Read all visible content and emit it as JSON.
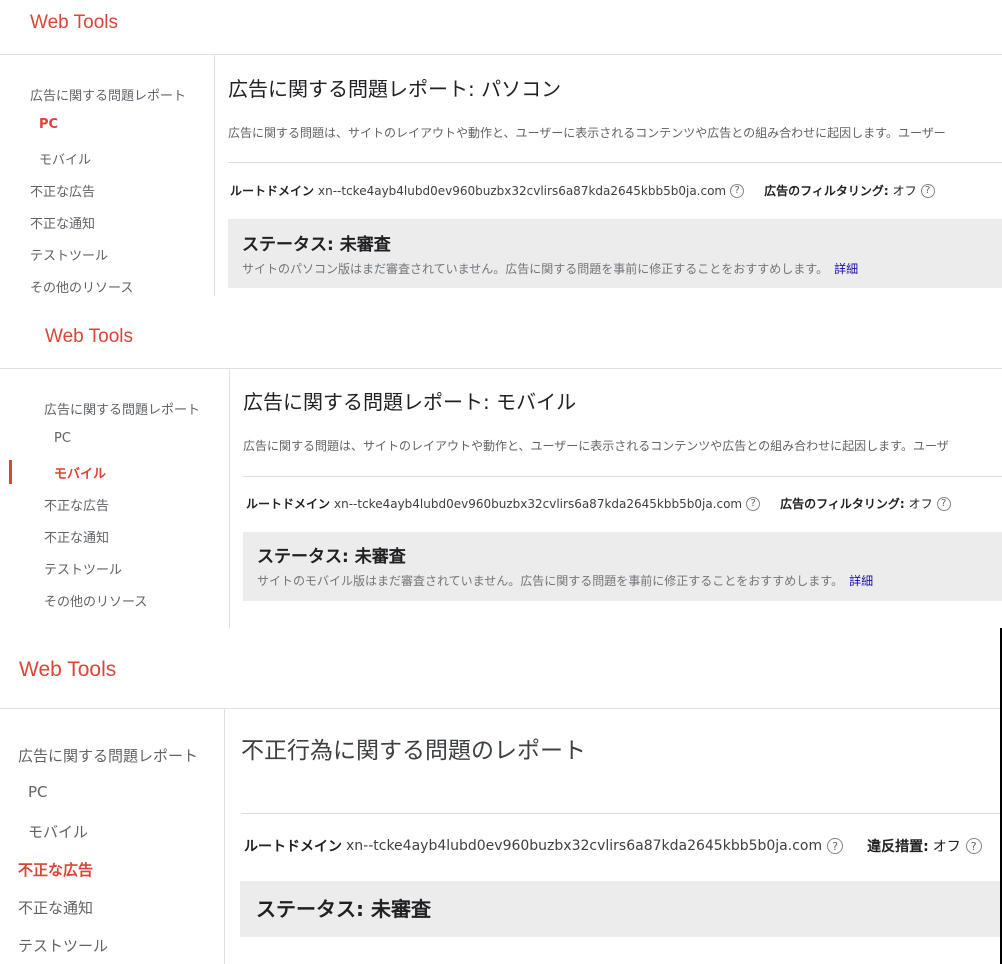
{
  "brand": "Web Tools",
  "panels": [
    {
      "nav": [
        "広告に関する問題レポート",
        "PC",
        "モバイル",
        "不正な広告",
        "不正な通知",
        "テストツール",
        "その他のリソース"
      ],
      "active_index": 1,
      "title": "広告に関する問題レポート: パソコン",
      "description": "広告に関する問題は、サイトのレイアウトや動作と、ユーザーに表示されるコンテンツや広告との組み合わせに起因します。ユーザー",
      "domain_label": "ルートドメイン",
      "domain": "xn--tcke4ayb4lubd0ev960buzbx32cvlirs6a87kda2645kbb5b0ja.com",
      "filter_label": "広告のフィルタリング:",
      "filter_value": "オフ",
      "status": "ステータス: 未審査",
      "status_desc": "サイトのパソコン版はまだ審査されていません。広告に関する問題を事前に修正することをおすすめします。",
      "details_link": "詳細"
    },
    {
      "nav": [
        "広告に関する問題レポート",
        "PC",
        "モバイル",
        "不正な広告",
        "不正な通知",
        "テストツール",
        "その他のリソース"
      ],
      "active_index": 2,
      "title": "広告に関する問題レポート: モバイル",
      "description": "広告に関する問題は、サイトのレイアウトや動作と、ユーザーに表示されるコンテンツや広告との組み合わせに起因します。ユーザ",
      "domain_label": "ルートドメイン",
      "domain": "xn--tcke4ayb4lubd0ev960buzbx32cvlirs6a87kda2645kbb5b0ja.com",
      "filter_label": "広告のフィルタリング:",
      "filter_value": "オフ",
      "status": "ステータス: 未審査",
      "status_desc": "サイトのモバイル版はまだ審査されていません。広告に関する問題を事前に修正することをおすすめします。",
      "details_link": "詳細"
    },
    {
      "nav": [
        "広告に関する問題レポート",
        "PC",
        "モバイル",
        "不正な広告",
        "不正な通知",
        "テストツール"
      ],
      "active_index": 3,
      "title": "不正行為に関する問題のレポート",
      "domain_label": "ルートドメイン",
      "domain": "xn--tcke4ayb4lubd0ev960buzbx32cvlirs6a87kda2645kbb5b0ja.com",
      "filter_label": "違反措置:",
      "filter_value": "オフ",
      "status": "ステータス: 未審査"
    }
  ],
  "help_glyph": "?",
  "icons": {
    "help": "help-circle-icon"
  },
  "colors": {
    "brand": "#db4437",
    "link": "#1a0dab",
    "status_bg": "#ececec"
  }
}
